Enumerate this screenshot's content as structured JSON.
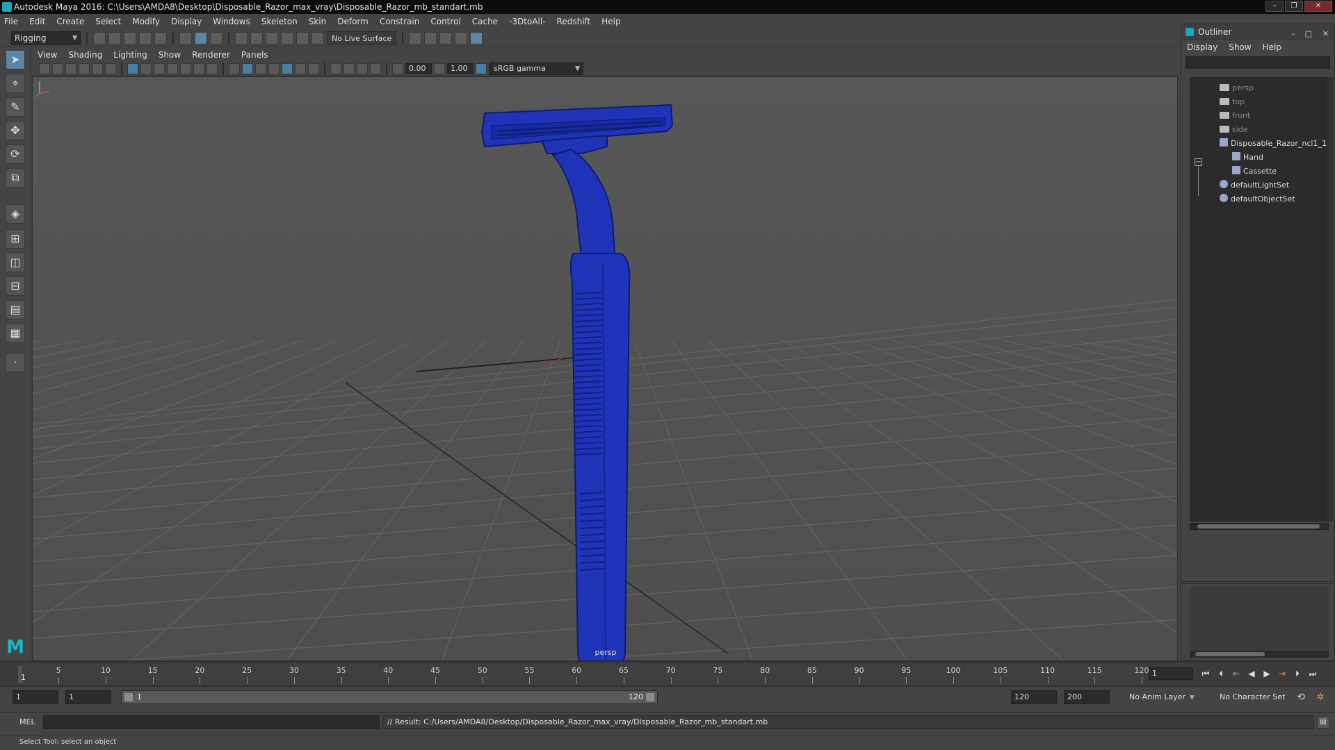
{
  "window": {
    "title": "Autodesk Maya 2016: C:\\Users\\AMDA8\\Desktop\\Disposable_Razor_max_vray\\Disposable_Razor_mb_standart.mb",
    "buttons": [
      "–",
      "❐",
      "✕"
    ]
  },
  "menubar": [
    "File",
    "Edit",
    "Create",
    "Select",
    "Modify",
    "Display",
    "Windows",
    "Skeleton",
    "Skin",
    "Deform",
    "Constrain",
    "Control",
    "Cache",
    "-3DtoAll-",
    "Redshift",
    "Help"
  ],
  "shelf": {
    "mode": "Rigging",
    "live_surface": "No Live Surface"
  },
  "viewport": {
    "menu": [
      "View",
      "Shading",
      "Lighting",
      "Show",
      "Renderer",
      "Panels"
    ],
    "exposure": "0.00",
    "gamma": "1.00",
    "color_space": "sRGB gamma",
    "camera_label": "persp",
    "model_color": "#1f34b8"
  },
  "outliner": {
    "title": "Outliner",
    "window_buttons": [
      "–",
      "□",
      "✕"
    ],
    "menu": [
      "Display",
      "Show",
      "Help"
    ],
    "items": [
      {
        "label": "persp",
        "icon": "camera-icon",
        "dim": true
      },
      {
        "label": "top",
        "icon": "camera-icon",
        "dim": true
      },
      {
        "label": "front",
        "icon": "camera-icon",
        "dim": true
      },
      {
        "label": "side",
        "icon": "camera-icon",
        "dim": true
      },
      {
        "label": "Disposable_Razor_ncl1_1",
        "icon": "group-icon",
        "dim": false
      },
      {
        "label": "Hand",
        "icon": "mesh-icon",
        "dim": false
      },
      {
        "label": "Cassette",
        "icon": "mesh-icon",
        "dim": false
      },
      {
        "label": "defaultLightSet",
        "icon": "set-icon",
        "dim": false
      },
      {
        "label": "defaultObjectSet",
        "icon": "set-icon",
        "dim": false
      }
    ]
  },
  "timeline": {
    "ticks": [
      "1",
      "5",
      "10",
      "15",
      "20",
      "25",
      "30",
      "35",
      "40",
      "45",
      "50",
      "55",
      "60",
      "65",
      "70",
      "75",
      "80",
      "85",
      "90",
      "95",
      "100",
      "105",
      "110",
      "115",
      "120"
    ],
    "current_frame": "1",
    "current_frame_field": "1"
  },
  "range": {
    "start_field": "1",
    "playback_start": "1",
    "slider_start": "1",
    "slider_end": "120",
    "playback_end": "120",
    "end_field": "200",
    "anim_layer": "No Anim Layer",
    "character_set": "No Character Set"
  },
  "command": {
    "language": "MEL",
    "result": "// Result: C:/Users/AMDA8/Desktop/Disposable_Razor_max_vray/Disposable_Razor_mb_standart.mb"
  },
  "helpline": "Select Tool: select an object",
  "colors": {
    "accent": "#5c86a8",
    "maya_teal": "#1aa7b8",
    "key_orange": "#e28a3c"
  }
}
